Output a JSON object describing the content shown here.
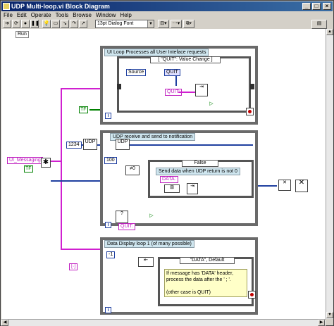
{
  "window": {
    "title": "UDP Multi-loop.vi Block Diagram"
  },
  "menu": [
    "File",
    "Edit",
    "Operate",
    "Tools",
    "Browse",
    "Window",
    "Help"
  ],
  "toolbar": {
    "font": "13pt Dialog Font"
  },
  "run_label": "Run",
  "loops": {
    "ui": {
      "title": "UI Loop Processes all User Inteface requests",
      "selector": "[ \"QUIT\": Value Change ]",
      "source": "Source",
      "quit_const": "QUIT",
      "quit_enqueue": "QUIT:",
      "true_const": "TF",
      "iter": "i"
    },
    "udp": {
      "title": "UDP receive and send to notification",
      "port": "1234",
      "timeout": "100",
      "case_selector": "False",
      "case_note": "Send data when UDP return is not 0",
      "data_const": "DATA:",
      "quit_enqueue": "QUIT:",
      "iter": "i"
    },
    "display": {
      "title": "Data Display loop 1 (of many possible)",
      "neg_one": "-1",
      "case_selector": "\"DATA\", Default",
      "note": "If message has 'DATA' header, process the data after the ' ; '.\n\n(other case is QUIT)",
      "iter": "i"
    }
  },
  "queue_name": "UI_Messaging",
  "queue_bool": "TF"
}
